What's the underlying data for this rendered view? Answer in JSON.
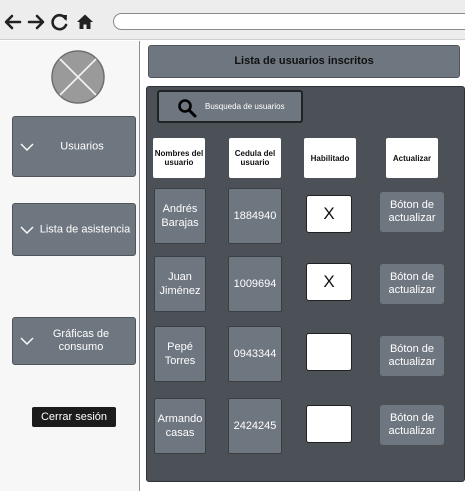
{
  "browser": {
    "back_icon": "arrow-left-icon",
    "forward_icon": "arrow-right-icon",
    "reload_icon": "reload-icon",
    "home_icon": "home-icon",
    "url": ""
  },
  "sidebar": {
    "logo_icon": "placeholder-x-logo",
    "items": [
      {
        "label": "Usuarios",
        "icon": "chevron-down-icon"
      },
      {
        "label": "Lista de asistencia",
        "icon": "chevron-down-icon"
      },
      {
        "label": "Gráficas de consumo",
        "icon": "chevron-down-icon"
      }
    ],
    "logout_label": "Cerrar sesión"
  },
  "main": {
    "title": "Lista de usuarios inscritos",
    "search_label": "Busqueda de usuarios",
    "search_icon": "search-icon",
    "columns": [
      "Nombres del usuario",
      "Cedula del usuario",
      "Habilitado",
      "Actualizar"
    ],
    "rows": [
      {
        "name": "Andrés Barajas",
        "cedula": "1884940",
        "enabled_mark": "X",
        "update_label": "Bóton de actualizar"
      },
      {
        "name": "Juan Jiménez",
        "cedula": "1009694",
        "enabled_mark": "X",
        "update_label": "Bóton de actualizar"
      },
      {
        "name": "Pepé Torres",
        "cedula": "0943344",
        "enabled_mark": "",
        "update_label": "Bóton de actualizar"
      },
      {
        "name": "Armando casas",
        "cedula": "2424245",
        "enabled_mark": "",
        "update_label": "Bóton de actualizar"
      }
    ]
  },
  "colors": {
    "panel_dark": "#4b5157",
    "button_gray": "#6e767f",
    "logout_black": "#1c1c1c"
  }
}
